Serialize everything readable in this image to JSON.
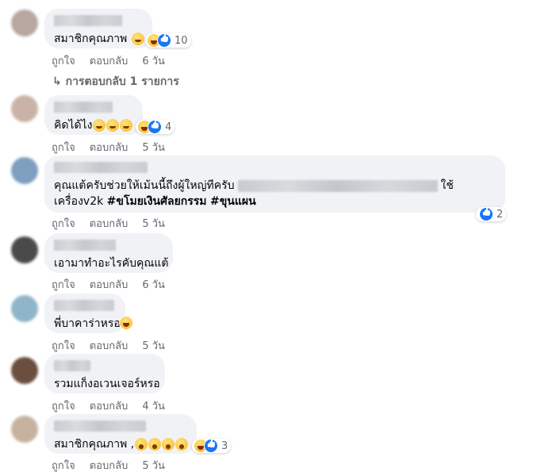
{
  "comments": [
    {
      "text": "สมาชิกคุณภาพ",
      "reaction_count": "10",
      "like_label": "ถูกใจ",
      "reply_label": "ตอบกลับ",
      "time": "6 วัน",
      "view_replies": "การตอบกลับ 1 รายการ"
    },
    {
      "text": "คิดได้ไง",
      "reaction_count": "4",
      "like_label": "ถูกใจ",
      "reply_label": "ตอบกลับ",
      "time": "5 วัน"
    },
    {
      "text_line1_start": "คุณแต้ครับช่วยให้เม้นนี้ถึงผู้ใหญ่ทีครับ",
      "text_line1_end": "ใช้",
      "text_line2_start": "เครื่องv2k ",
      "hashtag1": "#ขโมยเงินศัลยกรรม",
      "hashtag2": "#ขุนแผน",
      "reaction_count": "2",
      "like_label": "ถูกใจ",
      "reply_label": "ตอบกลับ",
      "time": "5 วัน"
    },
    {
      "text": "เอามาทำอะไรคับคุณแต้",
      "like_label": "ถูกใจ",
      "reply_label": "ตอบกลับ",
      "time": "6 วัน"
    },
    {
      "text": "พี่บาคาร่าหรอ",
      "like_label": "ถูกใจ",
      "reply_label": "ตอบกลับ",
      "time": "5 วัน"
    },
    {
      "text": "รวมแก็งอเวนเจอร์หรอ",
      "like_label": "ถูกใจ",
      "reply_label": "ตอบกลับ",
      "time": "4 วัน"
    },
    {
      "text": "สมาชิกคุณภาพ ,",
      "reaction_count": "3",
      "like_label": "ถูกใจ",
      "reply_label": "ตอบกลับ",
      "time": "5 วัน"
    }
  ],
  "colors": {
    "bubble": "#f0f2f5",
    "meta_text": "#65676b",
    "like_blue": "#1877f2",
    "haha_yellow": "#f7b928"
  }
}
